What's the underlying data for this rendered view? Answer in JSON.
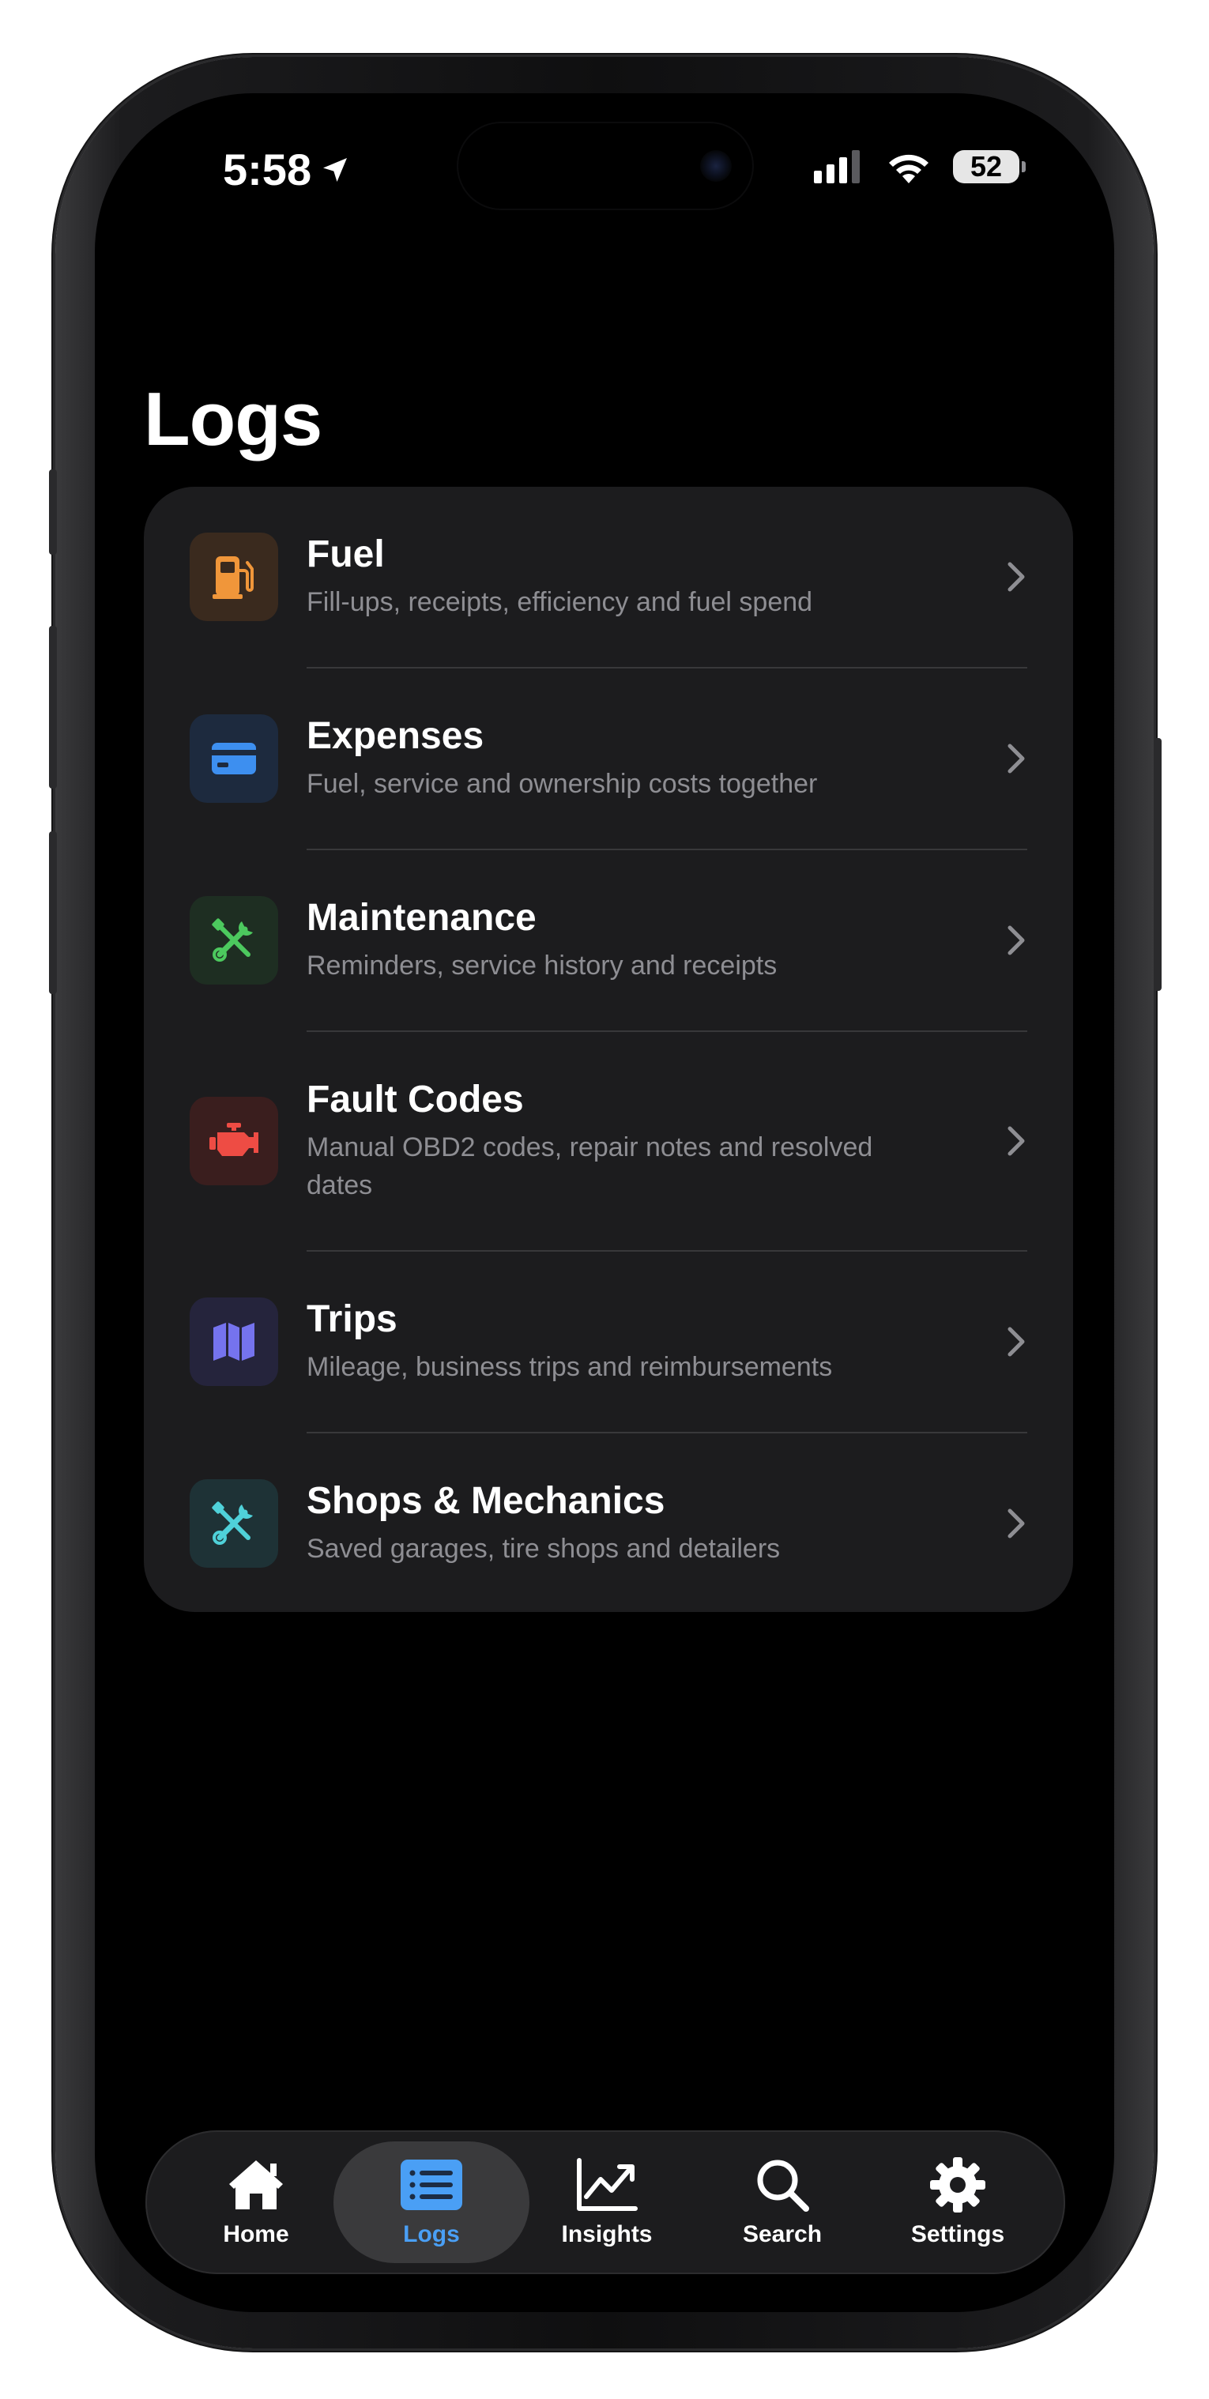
{
  "status_bar": {
    "time": "5:58",
    "battery_level": "52",
    "icons": [
      "location-arrow-icon",
      "cellular-signal-icon",
      "wifi-icon",
      "battery-icon"
    ]
  },
  "page": {
    "title": "Logs"
  },
  "logs": [
    {
      "title": "Fuel",
      "subtitle": "Fill-ups, receipts, efficiency and fuel spend",
      "icon": "fuel-pump-icon",
      "color": "#f0963a",
      "bg": "#3a2a1e"
    },
    {
      "title": "Expenses",
      "subtitle": "Fuel, service and ownership costs together",
      "icon": "credit-card-icon",
      "color": "#3d8ff0",
      "bg": "#1d2a3e"
    },
    {
      "title": "Maintenance",
      "subtitle": "Reminders, service history and receipts",
      "icon": "wrench-screwdriver-icon",
      "color": "#4cc95e",
      "bg": "#1e2e22"
    },
    {
      "title": "Fault Codes",
      "subtitle": "Manual OBD2 codes, repair notes and resolved dates",
      "icon": "engine-icon",
      "color": "#ee4c44",
      "bg": "#3a1e1e"
    },
    {
      "title": "Trips",
      "subtitle": "Mileage, business trips and reimbursements",
      "icon": "map-icon",
      "color": "#7573ee",
      "bg": "#25243c"
    },
    {
      "title": "Shops & Mechanics",
      "subtitle": "Saved garages, tire shops and detailers",
      "icon": "tools-icon",
      "color": "#4fd1d9",
      "bg": "#1e3236"
    }
  ],
  "tab_bar": {
    "active": "Logs",
    "tabs": [
      {
        "label": "Home",
        "icon": "house-icon"
      },
      {
        "label": "Logs",
        "icon": "list-icon"
      },
      {
        "label": "Insights",
        "icon": "chart-line-icon"
      },
      {
        "label": "Search",
        "icon": "magnifier-icon"
      },
      {
        "label": "Settings",
        "icon": "gear-icon"
      }
    ]
  },
  "colors": {
    "background": "#000000",
    "card": "#1c1c1e",
    "accent": "#4a9ff5",
    "secondary_text": "#8e8e93"
  }
}
